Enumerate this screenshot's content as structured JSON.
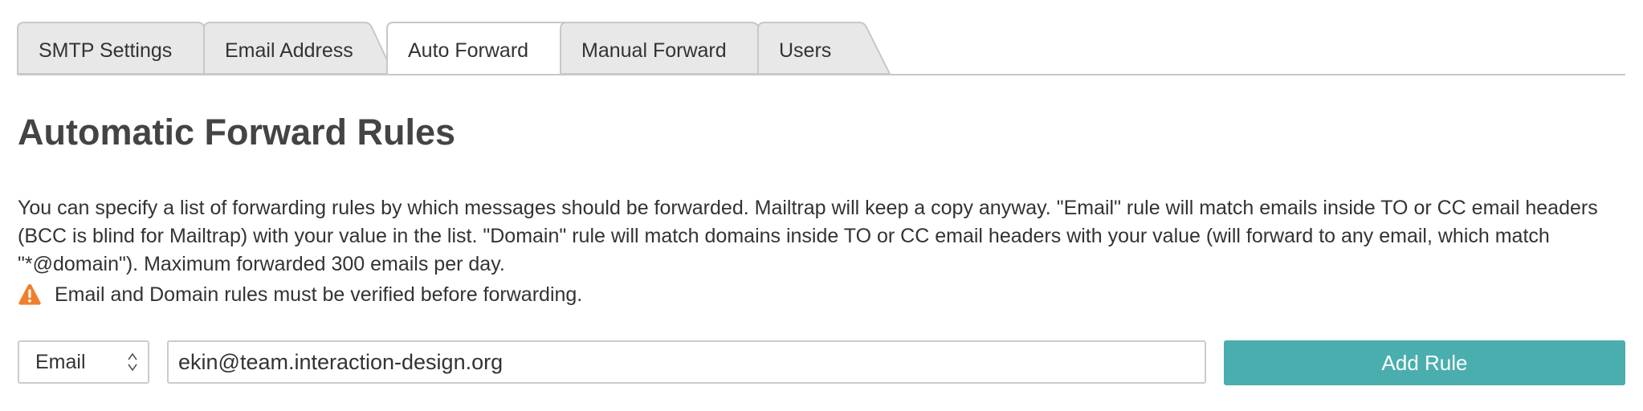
{
  "tabs": [
    {
      "label": "SMTP Settings",
      "active": false
    },
    {
      "label": "Email Address",
      "active": false
    },
    {
      "label": "Auto Forward",
      "active": true
    },
    {
      "label": "Manual Forward",
      "active": false
    },
    {
      "label": "Users",
      "active": false
    }
  ],
  "page": {
    "title": "Automatic Forward Rules",
    "description": "You can specify a list of forwarding rules by which messages should be forwarded. Mailtrap will keep a copy anyway. \"Email\" rule will match emails inside TO or CC email headers (BCC is blind for Mailtrap) with your value in the list. \"Domain\" rule will match domains inside TO or CC email headers with your value (will forward to any email, which match \"*@domain\"). Maximum forwarded 300 emails per day.",
    "warning": "Email and Domain rules must be verified before forwarding."
  },
  "form": {
    "rule_type": "Email",
    "rule_value": "ekin@team.interaction-design.org",
    "add_button_label": "Add Rule"
  },
  "colors": {
    "accent": "#4aaeae",
    "warning": "#f07f2d",
    "tab_inactive": "#e8e8e8",
    "tab_active": "#ffffff"
  },
  "icons": {
    "warning": "warning-triangle-icon",
    "select_arrows": "sort-arrows-icon"
  }
}
